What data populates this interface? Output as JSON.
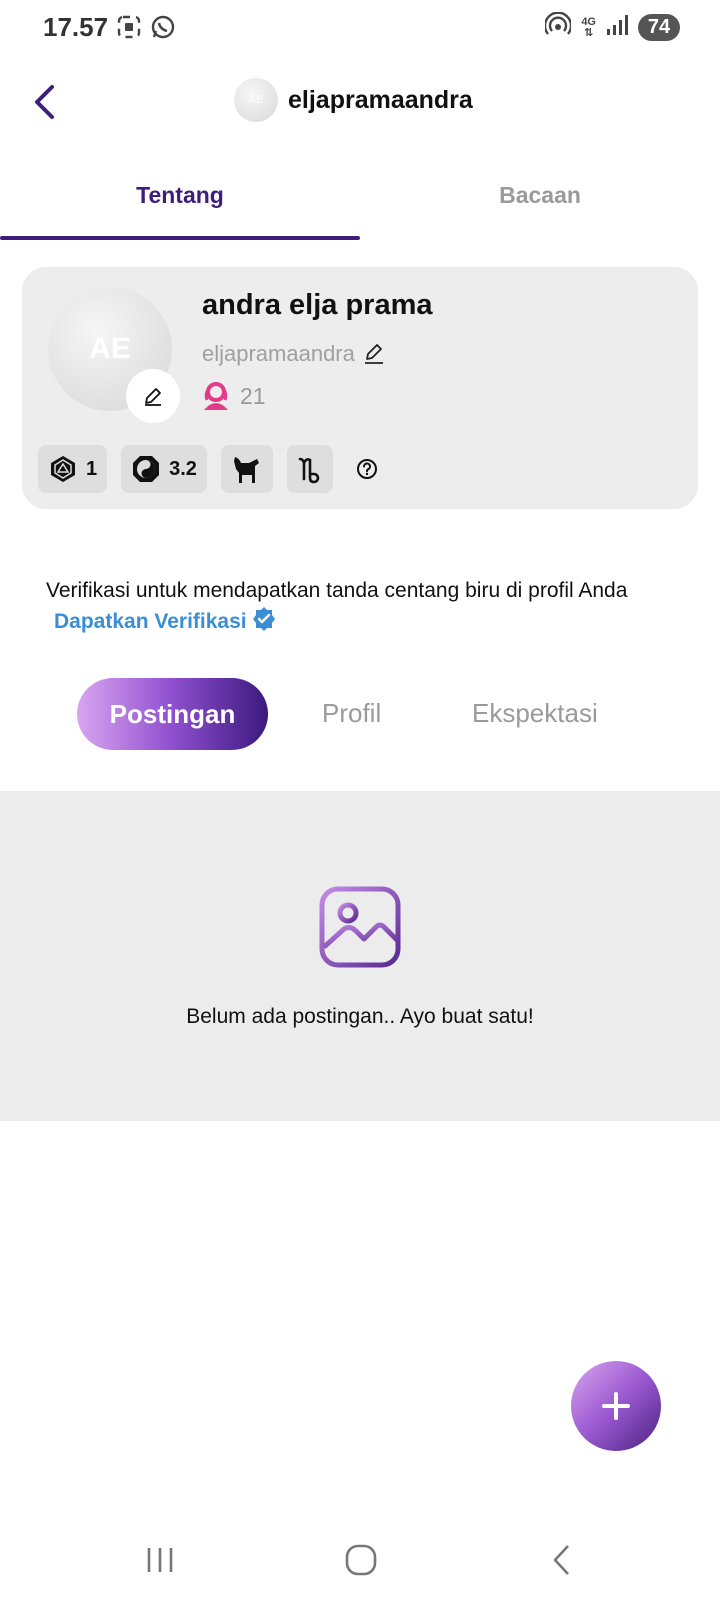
{
  "status_bar": {
    "time": "17.57",
    "network": "4G",
    "battery": "74"
  },
  "header": {
    "avatar_initials": "AE",
    "username": "eljapramaandra"
  },
  "top_tabs": [
    {
      "label": "Tentang",
      "active": true
    },
    {
      "label": "Bacaan",
      "active": false
    }
  ],
  "profile": {
    "avatar_initials": "AE",
    "name": "andra elja prama",
    "username": "eljapramaandra",
    "age": "21",
    "badges": [
      {
        "icon": "dice-icon",
        "value": "1"
      },
      {
        "icon": "yin-yang-icon",
        "value": "3.2"
      },
      {
        "icon": "goat-icon",
        "value": ""
      },
      {
        "icon": "capricorn-icon",
        "value": ""
      }
    ]
  },
  "verification": {
    "text": "Verifikasi untuk mendapatkan tanda centang biru di profil Anda",
    "link": "Dapatkan Verifikasi"
  },
  "segment_tabs": {
    "active": "Postingan",
    "profil": "Profil",
    "ekspektasi": "Ekspektasi"
  },
  "posts": {
    "empty_text": "Belum ada postingan.. Ayo buat satu!"
  },
  "colors": {
    "accent": "#3d1e7a",
    "link": "#3a8fd4",
    "gradient_start": "#d9a5f0",
    "gradient_end": "#3a1a7d"
  }
}
